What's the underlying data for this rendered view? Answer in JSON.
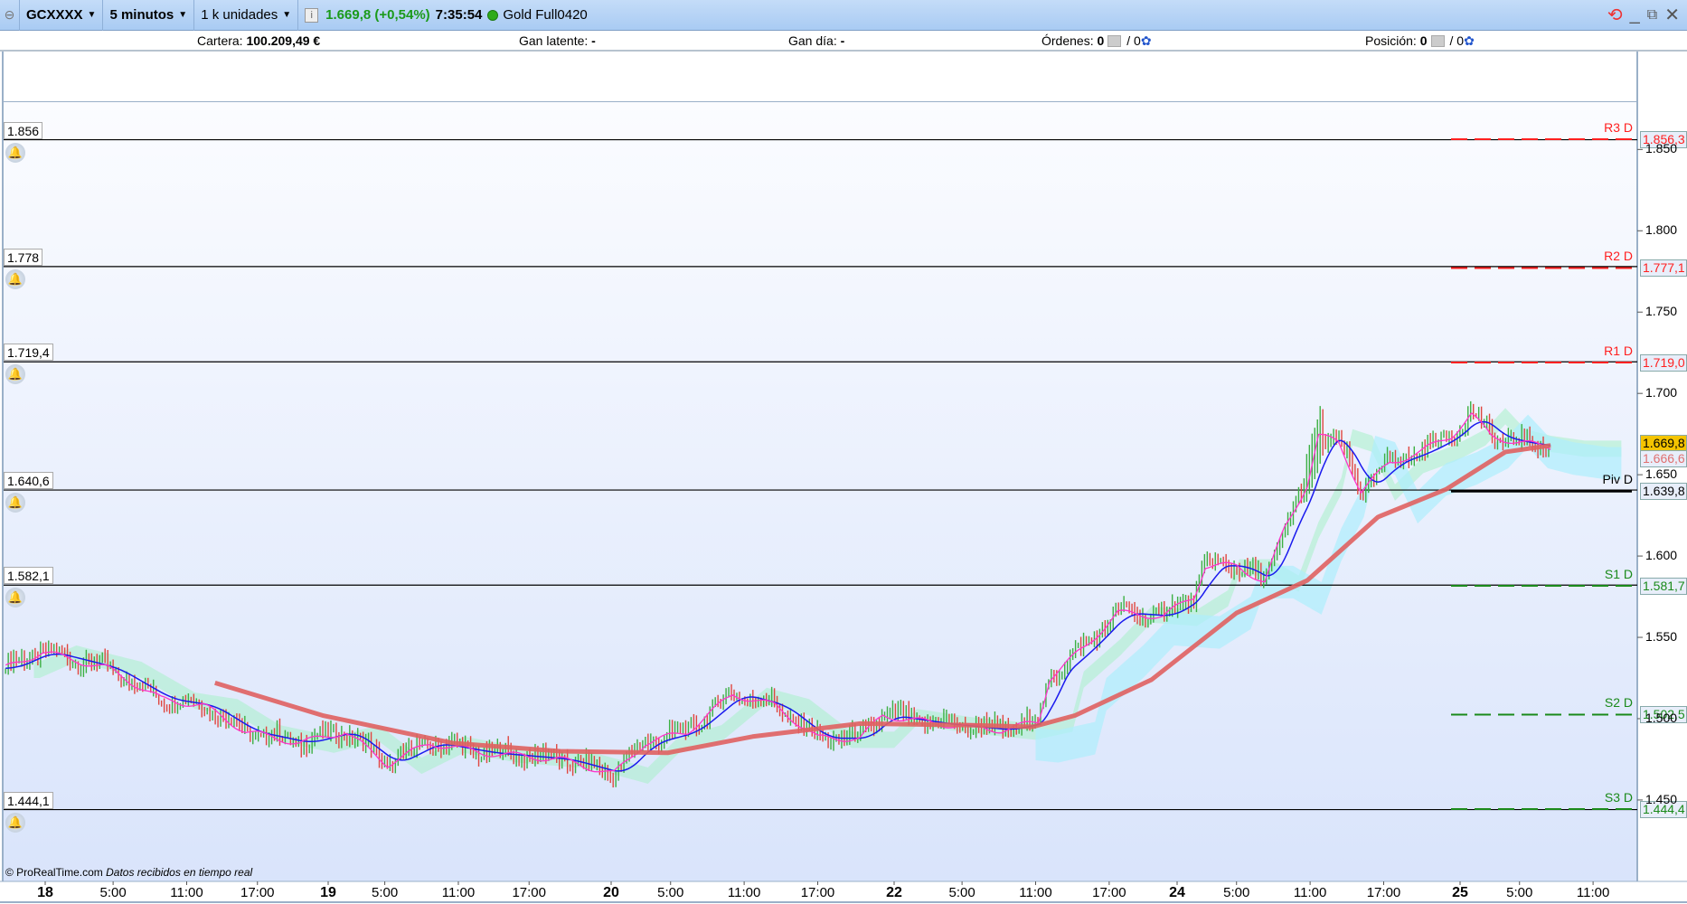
{
  "toolbar": {
    "symbol": "GCXXXX",
    "timeframe": "5 minutos",
    "units": "1 k unidades",
    "price": "1.669,8 (+0,54%)",
    "time": "7:35:54",
    "feed": "Gold Full0420"
  },
  "infobar": {
    "cartera_label": "Cartera:",
    "cartera_value": "100.209,49 €",
    "gan_latente_label": "Gan latente:",
    "gan_latente_value": "-",
    "gan_dia_label": "Gan día:",
    "gan_dia_value": "-",
    "ordenes_label": "Órdenes:",
    "ordenes_value": "0",
    "ordenes_value2": "/ 0",
    "posicion_label": "Posición:",
    "posicion_value": "0",
    "posicion_value2": "/ 0"
  },
  "footer": {
    "copyright": "© ProRealTime.com",
    "realtime": "Datos recibidos en tiempo real"
  },
  "colors": {
    "up": "#3cb043",
    "down": "#e0463f",
    "price_line": "#ff33cc",
    "signal_line": "#1a1aee",
    "sma": "#e06060",
    "resistance": "#ff2020",
    "support": "#1a8a1a"
  },
  "chart_data": {
    "type": "line",
    "x_unit": "trading sessions from day 18",
    "x_ticks": [
      {
        "t": 0,
        "label": "18",
        "day": true
      },
      {
        "t": 0.24,
        "label": "5:00"
      },
      {
        "t": 0.5,
        "label": "11:00"
      },
      {
        "t": 0.75,
        "label": "17:00"
      },
      {
        "t": 1,
        "label": "19",
        "day": true
      },
      {
        "t": 1.2,
        "label": "5:00"
      },
      {
        "t": 1.46,
        "label": "11:00"
      },
      {
        "t": 1.71,
        "label": "17:00"
      },
      {
        "t": 2,
        "label": "20",
        "day": true
      },
      {
        "t": 2.21,
        "label": "5:00"
      },
      {
        "t": 2.47,
        "label": "11:00"
      },
      {
        "t": 2.73,
        "label": "17:00"
      },
      {
        "t": 3,
        "label": "22",
        "day": true
      },
      {
        "t": 3.24,
        "label": "5:00"
      },
      {
        "t": 3.5,
        "label": "11:00"
      },
      {
        "t": 3.76,
        "label": "17:00"
      },
      {
        "t": 4,
        "label": "24",
        "day": true
      },
      {
        "t": 4.21,
        "label": "5:00"
      },
      {
        "t": 4.47,
        "label": "11:00"
      },
      {
        "t": 4.73,
        "label": "17:00"
      },
      {
        "t": 5,
        "label": "25",
        "day": true
      },
      {
        "t": 5.21,
        "label": "5:00"
      },
      {
        "t": 5.47,
        "label": "11:00"
      }
    ],
    "y_ticks": [
      "1.850",
      "1.800",
      "1.750",
      "1.700",
      "1.650",
      "1.600",
      "1.550",
      "1.500",
      "1.450"
    ],
    "y_tick_values": [
      1.85,
      1.8,
      1.75,
      1.7,
      1.65,
      1.6,
      1.55,
      1.5,
      1.45
    ],
    "ylim": [
      1.398,
      1.889
    ],
    "price": [
      [
        -0.14,
        1.531
      ],
      [
        -0.01,
        1.541
      ],
      [
        0.22,
        1.531
      ],
      [
        0.41,
        1.512
      ],
      [
        0.56,
        1.508
      ],
      [
        0.71,
        1.492
      ],
      [
        0.9,
        1.485
      ],
      [
        1.06,
        1.492
      ],
      [
        1.21,
        1.472
      ],
      [
        1.36,
        1.485
      ],
      [
        1.55,
        1.479
      ],
      [
        1.82,
        1.475
      ],
      [
        2.01,
        1.466
      ],
      [
        2.12,
        1.485
      ],
      [
        2.27,
        1.492
      ],
      [
        2.43,
        1.515
      ],
      [
        2.58,
        1.508
      ],
      [
        2.73,
        1.488
      ],
      [
        2.88,
        1.488
      ],
      [
        2.96,
        1.502
      ],
      [
        3.15,
        1.497
      ],
      [
        3.38,
        1.493
      ],
      [
        3.51,
        1.498
      ],
      [
        3.55,
        1.525
      ],
      [
        3.68,
        1.545
      ],
      [
        3.79,
        1.565
      ],
      [
        3.95,
        1.563
      ],
      [
        4.06,
        1.575
      ],
      [
        4.1,
        1.594
      ],
      [
        4.21,
        1.594
      ],
      [
        4.31,
        1.584
      ],
      [
        4.38,
        1.617
      ],
      [
        4.46,
        1.644
      ],
      [
        4.5,
        1.674
      ],
      [
        4.57,
        1.67
      ],
      [
        4.65,
        1.64
      ],
      [
        4.75,
        1.657
      ],
      [
        4.86,
        1.664
      ],
      [
        4.97,
        1.674
      ],
      [
        5.04,
        1.687
      ],
      [
        5.11,
        1.674
      ],
      [
        5.2,
        1.67
      ],
      [
        5.32,
        1.667
      ]
    ],
    "sma": [
      [
        0.6,
        1.522
      ],
      [
        0.98,
        1.502
      ],
      [
        1.44,
        1.485
      ],
      [
        1.82,
        1.48
      ],
      [
        2.2,
        1.479
      ],
      [
        2.5,
        1.489
      ],
      [
        2.88,
        1.497
      ],
      [
        3.26,
        1.496
      ],
      [
        3.49,
        1.495
      ],
      [
        3.64,
        1.502
      ],
      [
        3.91,
        1.524
      ],
      [
        4.21,
        1.565
      ],
      [
        4.46,
        1.585
      ],
      [
        4.71,
        1.624
      ],
      [
        4.95,
        1.641
      ],
      [
        5.16,
        1.664
      ],
      [
        5.32,
        1.668
      ]
    ],
    "levels": [
      {
        "value": 1.856,
        "label": "1.856"
      },
      {
        "value": 1.778,
        "label": "1.778"
      },
      {
        "value": 1.7194,
        "label": "1.719,4"
      },
      {
        "value": 1.6406,
        "label": "1.640,6"
      },
      {
        "value": 1.5821,
        "label": "1.582,1"
      },
      {
        "value": 1.4441,
        "label": "1.444,1"
      }
    ],
    "pivots": [
      {
        "name": "R3 D",
        "value": 1.8563,
        "label": "1.856,3",
        "kind": "r"
      },
      {
        "name": "R2 D",
        "value": 1.7771,
        "label": "1.777,1",
        "kind": "r"
      },
      {
        "name": "R1 D",
        "value": 1.719,
        "label": "1.719,0",
        "kind": "r"
      },
      {
        "name": "Piv D",
        "value": 1.6398,
        "label": "1.639,8",
        "kind": "p"
      },
      {
        "name": "S1 D",
        "value": 1.5817,
        "label": "1.581,7",
        "kind": "s"
      },
      {
        "name": "S2 D",
        "value": 1.5025,
        "label": "1.502,5",
        "kind": "s"
      },
      {
        "name": "S3 D",
        "value": 1.4444,
        "label": "1.444,4",
        "kind": "s"
      }
    ],
    "last_price": {
      "value": 1.6698,
      "label": "1.669,8"
    },
    "sma_last": {
      "value": 1.6666,
      "label": "1.666,6"
    }
  }
}
